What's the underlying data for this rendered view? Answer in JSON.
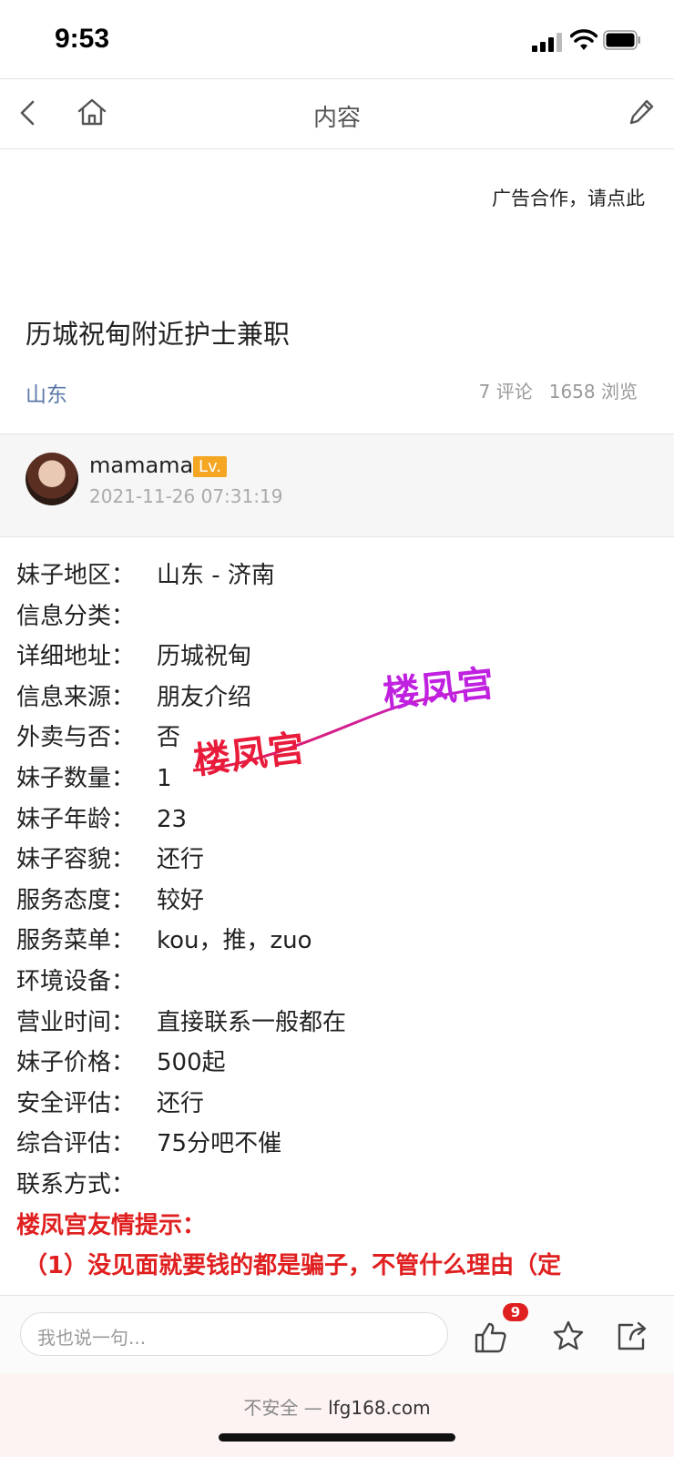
{
  "status": {
    "time": "9:53"
  },
  "nav": {
    "title": "内容"
  },
  "ad": {
    "text": "广告合作，请点此"
  },
  "post": {
    "title": "历城祝甸附近护士兼职",
    "region": "山东",
    "comments": "7 评论",
    "views": "1658 浏览"
  },
  "author": {
    "name": "mamama",
    "level": "Lv.",
    "date": "2021-11-26 07:31:19"
  },
  "info": [
    {
      "key": "妹子地区：",
      "value": "山东 - 济南"
    },
    {
      "key": "信息分类：",
      "value": ""
    },
    {
      "key": "详细地址：",
      "value": "历城祝甸"
    },
    {
      "key": "信息来源：",
      "value": "朋友介绍"
    },
    {
      "key": "外卖与否：",
      "value": "否"
    },
    {
      "key": "妹子数量：",
      "value": "1"
    },
    {
      "key": "妹子年龄：",
      "value": "23"
    },
    {
      "key": "妹子容貌：",
      "value": "还行"
    },
    {
      "key": "服务态度：",
      "value": "较好"
    },
    {
      "key": "服务菜单：",
      "value": "kou，推，zuo"
    },
    {
      "key": "环境设备：",
      "value": ""
    },
    {
      "key": "营业时间：",
      "value": "直接联系一般都在"
    },
    {
      "key": "妹子价格：",
      "value": "500起"
    },
    {
      "key": "安全评估：",
      "value": "还行"
    },
    {
      "key": "综合评估：",
      "value": "75分吧不催"
    },
    {
      "key": "联系方式：",
      "value": ""
    }
  ],
  "tip": {
    "title": "楼凤宫友情提示：",
    "line1": "（1）没见面就要钱的都是骗子，不管什么理由（定"
  },
  "watermark": {
    "left": "楼凤宫",
    "right": "楼凤宫"
  },
  "bottom": {
    "placeholder": "我也说一句...",
    "likes": "9"
  },
  "browser": {
    "insecure": "不安全 —",
    "host": "lfg168.com"
  },
  "colors": {
    "accent_red": "#e02020",
    "region_blue": "#5a78a8",
    "level_badge": "#f5a623"
  }
}
